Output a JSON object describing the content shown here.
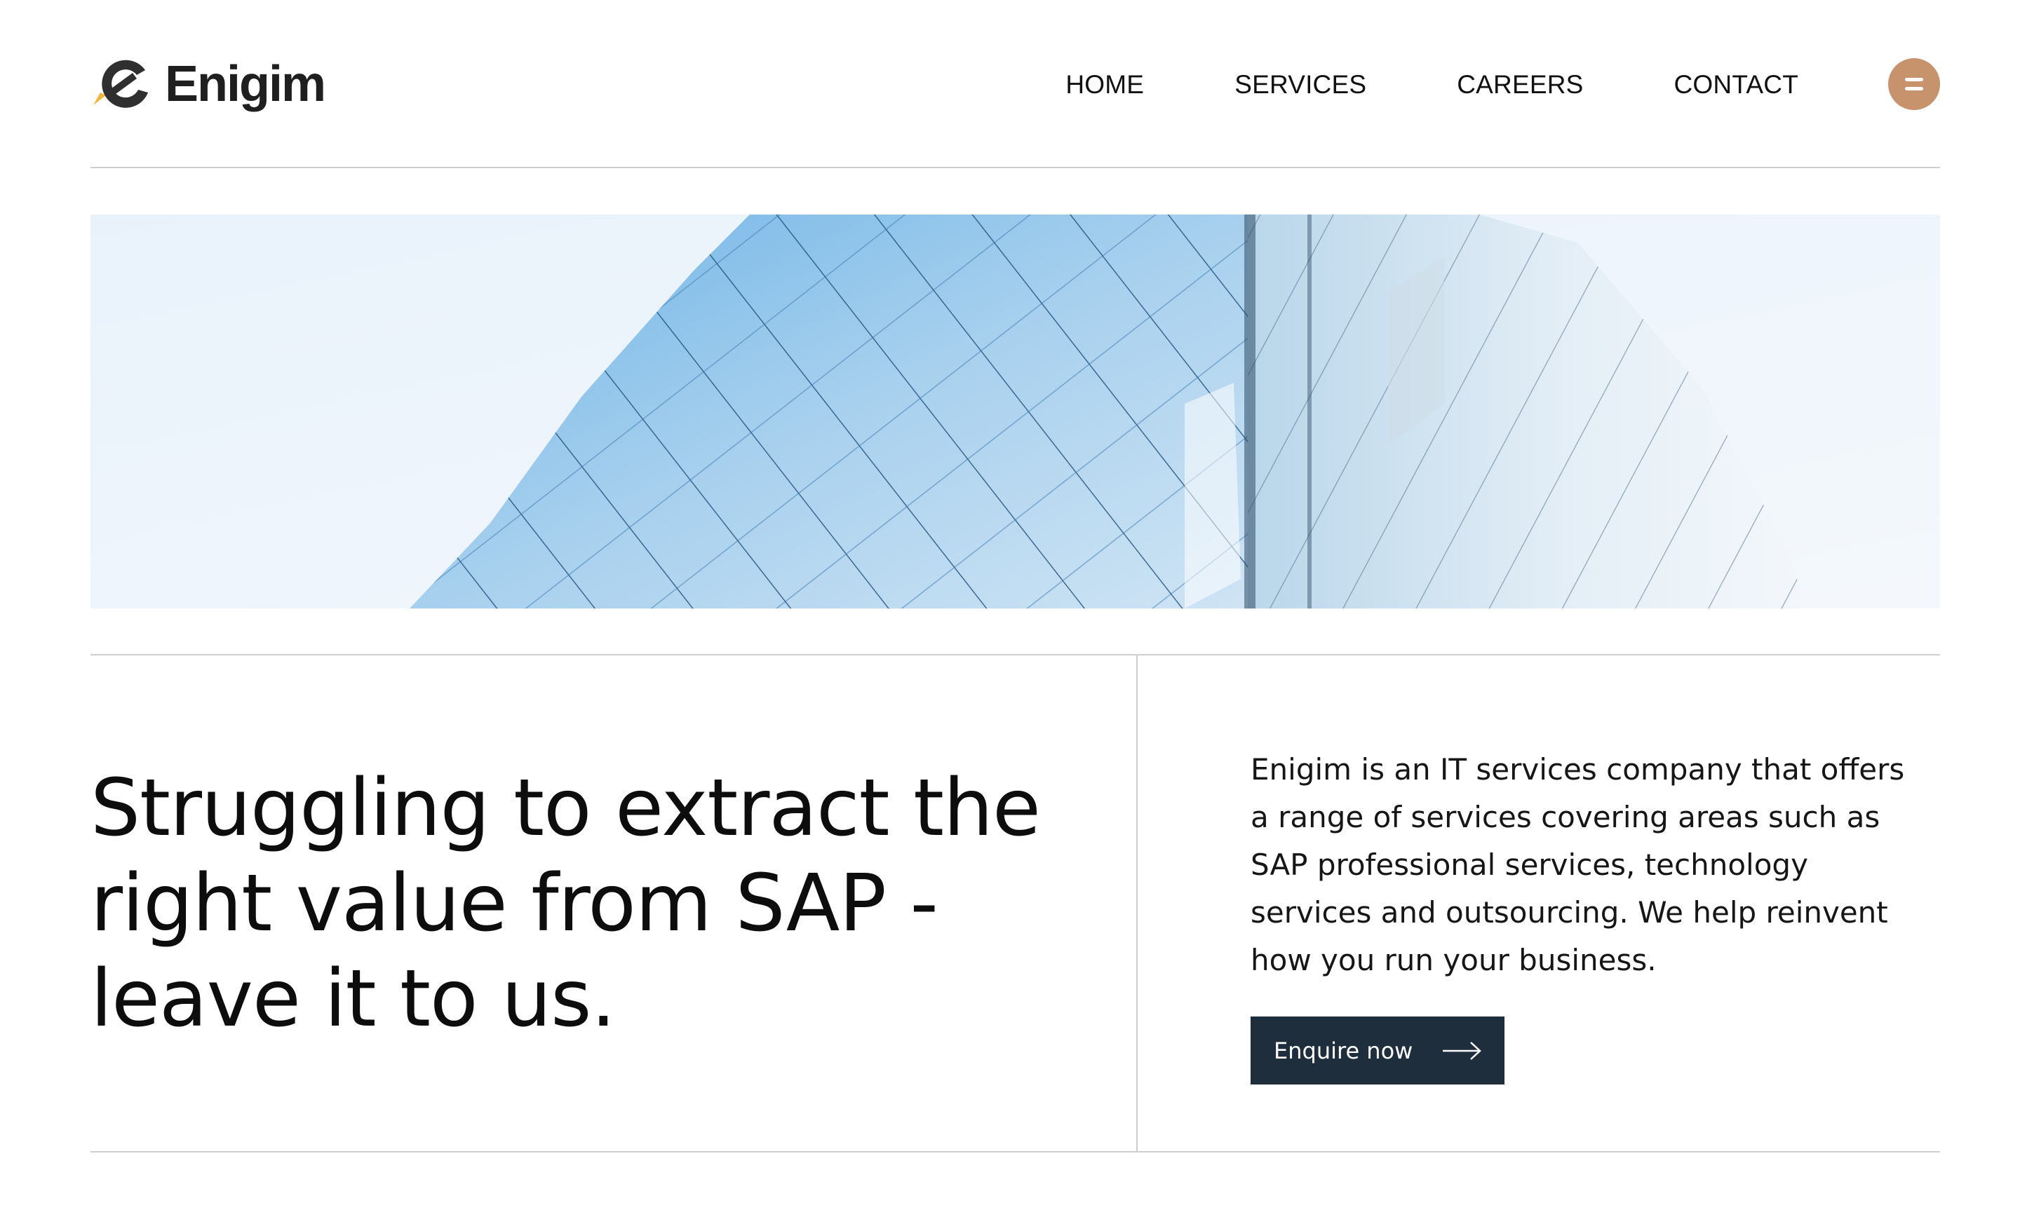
{
  "brand": {
    "name": "Enigim",
    "accent_color": "#c6936d",
    "dark_color": "#1f2e3d",
    "logo_icon": "e-swoosh-logo-icon"
  },
  "nav": {
    "items": [
      {
        "label": "HOME"
      },
      {
        "label": "SERVICES"
      },
      {
        "label": "CAREERS"
      },
      {
        "label": "CONTACT"
      }
    ],
    "menu_icon": "menu-icon"
  },
  "hero": {
    "image_subject": "glass-building-facade"
  },
  "main": {
    "headline": "Struggling to extract the right value from SAP - leave it to us.",
    "description": "Enigim is an IT services company that offers a range of services covering areas such as SAP professional services, technology services and outsourcing. We help reinvent how you run your business.",
    "cta": {
      "label": "Enquire now",
      "icon": "arrow-right-icon"
    }
  }
}
